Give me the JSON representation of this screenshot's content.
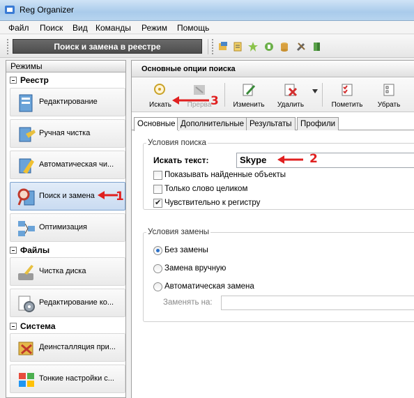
{
  "window": {
    "title": "Reg Organizer"
  },
  "menu": [
    "Файл",
    "Поиск",
    "Вид",
    "Команды",
    "Режим",
    "Помощь"
  ],
  "mode_title": "Поиск и замена в реестре",
  "left_panel": {
    "header": "Режимы",
    "groups": [
      {
        "title": "Реестр",
        "items": [
          "Редактирование",
          "Ручная чистка",
          "Автоматическая чи...",
          "Поиск и замена",
          "Оптимизация"
        ]
      },
      {
        "title": "Файлы",
        "items": [
          "Чистка диска",
          "Редактирование ко..."
        ]
      },
      {
        "title": "Система",
        "items": [
          "Деинсталляция при...",
          "Тонкие настройки с..."
        ]
      }
    ]
  },
  "right_panel": {
    "header": "Основные опции поиска",
    "actions": {
      "search": "Искать",
      "stop": "Прерва",
      "edit": "Изменить",
      "delete": "Удалить",
      "mark": "Пометить",
      "remove": "Убрать"
    },
    "tabs": [
      "Основные",
      "Дополнительные",
      "Результаты",
      "Профили"
    ],
    "search_group": {
      "legend": "Условия поиска",
      "search_label": "Искать текст:",
      "search_value": "Skype",
      "options": [
        {
          "label": "Показывать найденные объекты",
          "checked": false
        },
        {
          "label": "Только слово целиком",
          "checked": false
        },
        {
          "label": "Чувствительно к регистру",
          "checked": true
        }
      ]
    },
    "replace_group": {
      "legend": "Условия замены",
      "options": [
        {
          "label": "Без замены",
          "selected": true
        },
        {
          "label": "Замена вручную",
          "selected": false
        },
        {
          "label": "Автоматическая замена",
          "selected": false
        }
      ],
      "replace_label": "Заменять на:",
      "replace_value": ""
    }
  },
  "annotations": [
    "1",
    "2",
    "3"
  ],
  "colors": {
    "annotation": "#e02020",
    "mode_title_bg": "#555555",
    "active_item": "#c9dbf1"
  }
}
